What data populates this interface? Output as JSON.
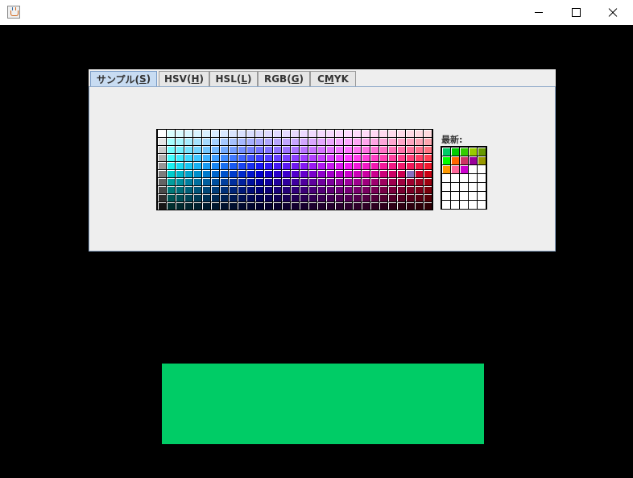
{
  "window": {
    "icon": "java-cup-icon"
  },
  "tabs": [
    {
      "pre": "サンプル(",
      "key": "S",
      "post": ")",
      "selected": true
    },
    {
      "pre": "HSV(",
      "key": "H",
      "post": ")",
      "selected": false
    },
    {
      "pre": "HSL(",
      "key": "L",
      "post": ")",
      "selected": false
    },
    {
      "pre": "RGB(",
      "key": "G",
      "post": ")",
      "selected": false
    },
    {
      "pre": "C",
      "key": "M",
      "post": "YK",
      "selected": false
    }
  ],
  "recent_label": "最新:",
  "recent_colors": [
    "#00cc66",
    "#00cc00",
    "#33cc00",
    "#99cc00",
    "#669900",
    "#00ff00",
    "#ff6600",
    "#cc3366",
    "#990099",
    "#999900",
    "#ff9900",
    "#ff6699",
    "#cc00cc",
    "#ffffff",
    "#ffffff",
    "#ffffff",
    "#ffffff",
    "#ffffff",
    "#ffffff",
    "#ffffff",
    "#ffffff",
    "#ffffff",
    "#ffffff",
    "#ffffff",
    "#ffffff",
    "#ffffff",
    "#ffffff",
    "#ffffff",
    "#ffffff",
    "#ffffff",
    "#ffffff",
    "#ffffff",
    "#ffffff",
    "#ffffff",
    "#ffffff"
  ],
  "preview_color": "#00cc66",
  "selected_swatch": {
    "row": 5,
    "col": 28
  }
}
